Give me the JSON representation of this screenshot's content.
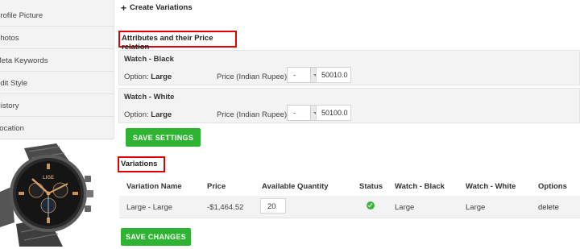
{
  "sidebar": {
    "items": [
      {
        "label": "Profile Picture"
      },
      {
        "label": "Photos"
      },
      {
        "label": "Meta Keywords"
      },
      {
        "label": "Edit Style"
      },
      {
        "label": "History"
      },
      {
        "label": "Location"
      }
    ]
  },
  "product_image": {
    "brand_text": "LIGE"
  },
  "create_variations": {
    "label": "Create Variations",
    "icon": "plus-icon"
  },
  "attributes": {
    "heading": "Attributes and their Price relation",
    "rows": [
      {
        "title": "Watch - Black",
        "option_label": "Option:",
        "option_value": "Large",
        "price_label": "Price (Indian Rupee):",
        "sign": "-",
        "amount": "50010.0"
      },
      {
        "title": "Watch - White",
        "option_label": "Option:",
        "option_value": "Large",
        "price_label": "Price (Indian Rupee):",
        "sign": "-",
        "amount": "50100.0"
      }
    ],
    "save_settings": "SAVE SETTINGS"
  },
  "variations": {
    "heading": "Variations",
    "columns": [
      "Variation Name",
      "Price",
      "Available Quantity",
      "Status",
      "Watch - Black",
      "Watch - White",
      "Options"
    ],
    "rows": [
      {
        "name": "Large - Large",
        "price": "-$1,464.52",
        "quantity": "20",
        "status": "active",
        "watch_black": "Large",
        "watch_white": "Large",
        "option": "delete"
      }
    ],
    "save_changes": "SAVE CHANGES"
  },
  "colors": {
    "accent_green": "#2fb333",
    "highlight_red": "#e30000",
    "status_green": "#3cb43c"
  }
}
